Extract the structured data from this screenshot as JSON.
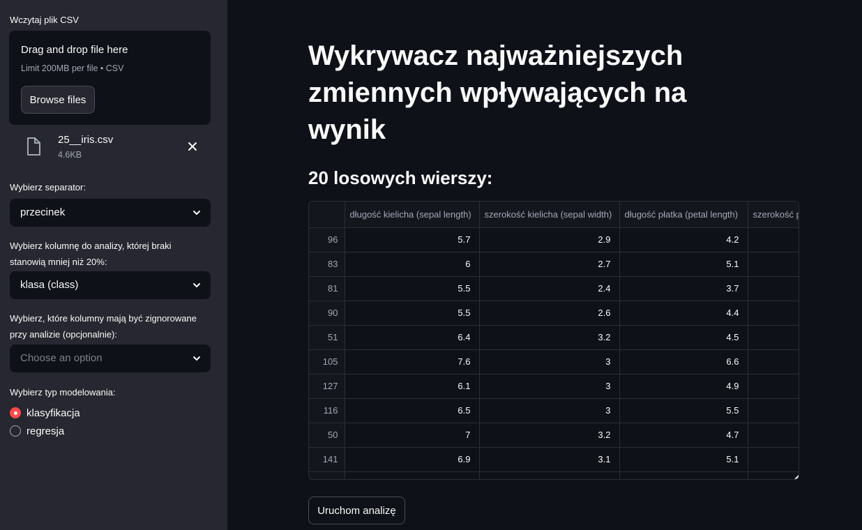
{
  "sidebar": {
    "upload_label": "Wczytaj plik CSV",
    "dropzone": {
      "title": "Drag and drop file here",
      "limit": "Limit 200MB per file • CSV",
      "browse_label": "Browse files"
    },
    "file": {
      "name": "25__iris.csv",
      "size": "4.6KB"
    },
    "separator": {
      "label": "Wybierz separator:",
      "value": "przecinek"
    },
    "column": {
      "label_line1": "Wybierz kolumnę do analizy, której braki",
      "label_line2": "stanowią mniej niż 20%:",
      "value": "klasa (class)"
    },
    "ignore": {
      "label_line1": "Wybierz, które kolumny mają być zignorowane",
      "label_line2": "przy analizie (opcjonalnie):",
      "placeholder": "Choose an option"
    },
    "model_type": {
      "label": "Wybierz typ modelowania:",
      "options": [
        {
          "label": "klasyfikacja",
          "selected": true
        },
        {
          "label": "regresja",
          "selected": false
        }
      ]
    }
  },
  "main": {
    "title": "Wykrywacz najważniejszych zmiennych wpływających na wynik",
    "subtitle": "20 losowych wierszy:",
    "table": {
      "columns": [
        "długość kielicha (sepal length)",
        "szerokość kielicha (sepal width)",
        "długość płatka (petal length)",
        "szerokość p"
      ],
      "rows": [
        {
          "index": "96",
          "cells": [
            "5.7",
            "2.9",
            "4.2",
            ""
          ]
        },
        {
          "index": "83",
          "cells": [
            "6",
            "2.7",
            "5.1",
            ""
          ]
        },
        {
          "index": "81",
          "cells": [
            "5.5",
            "2.4",
            "3.7",
            ""
          ]
        },
        {
          "index": "90",
          "cells": [
            "5.5",
            "2.6",
            "4.4",
            ""
          ]
        },
        {
          "index": "51",
          "cells": [
            "6.4",
            "3.2",
            "4.5",
            ""
          ]
        },
        {
          "index": "105",
          "cells": [
            "7.6",
            "3",
            "6.6",
            ""
          ]
        },
        {
          "index": "127",
          "cells": [
            "6.1",
            "3",
            "4.9",
            ""
          ]
        },
        {
          "index": "116",
          "cells": [
            "6.5",
            "3",
            "5.5",
            ""
          ]
        },
        {
          "index": "50",
          "cells": [
            "7",
            "3.2",
            "4.7",
            ""
          ]
        },
        {
          "index": "141",
          "cells": [
            "6.9",
            "3.1",
            "5.1",
            ""
          ]
        }
      ]
    },
    "run_button": "Uruchom analizę"
  },
  "colors": {
    "accent": "#ff4b4b",
    "sidebar_bg": "#262730",
    "main_bg": "#0e1117"
  }
}
